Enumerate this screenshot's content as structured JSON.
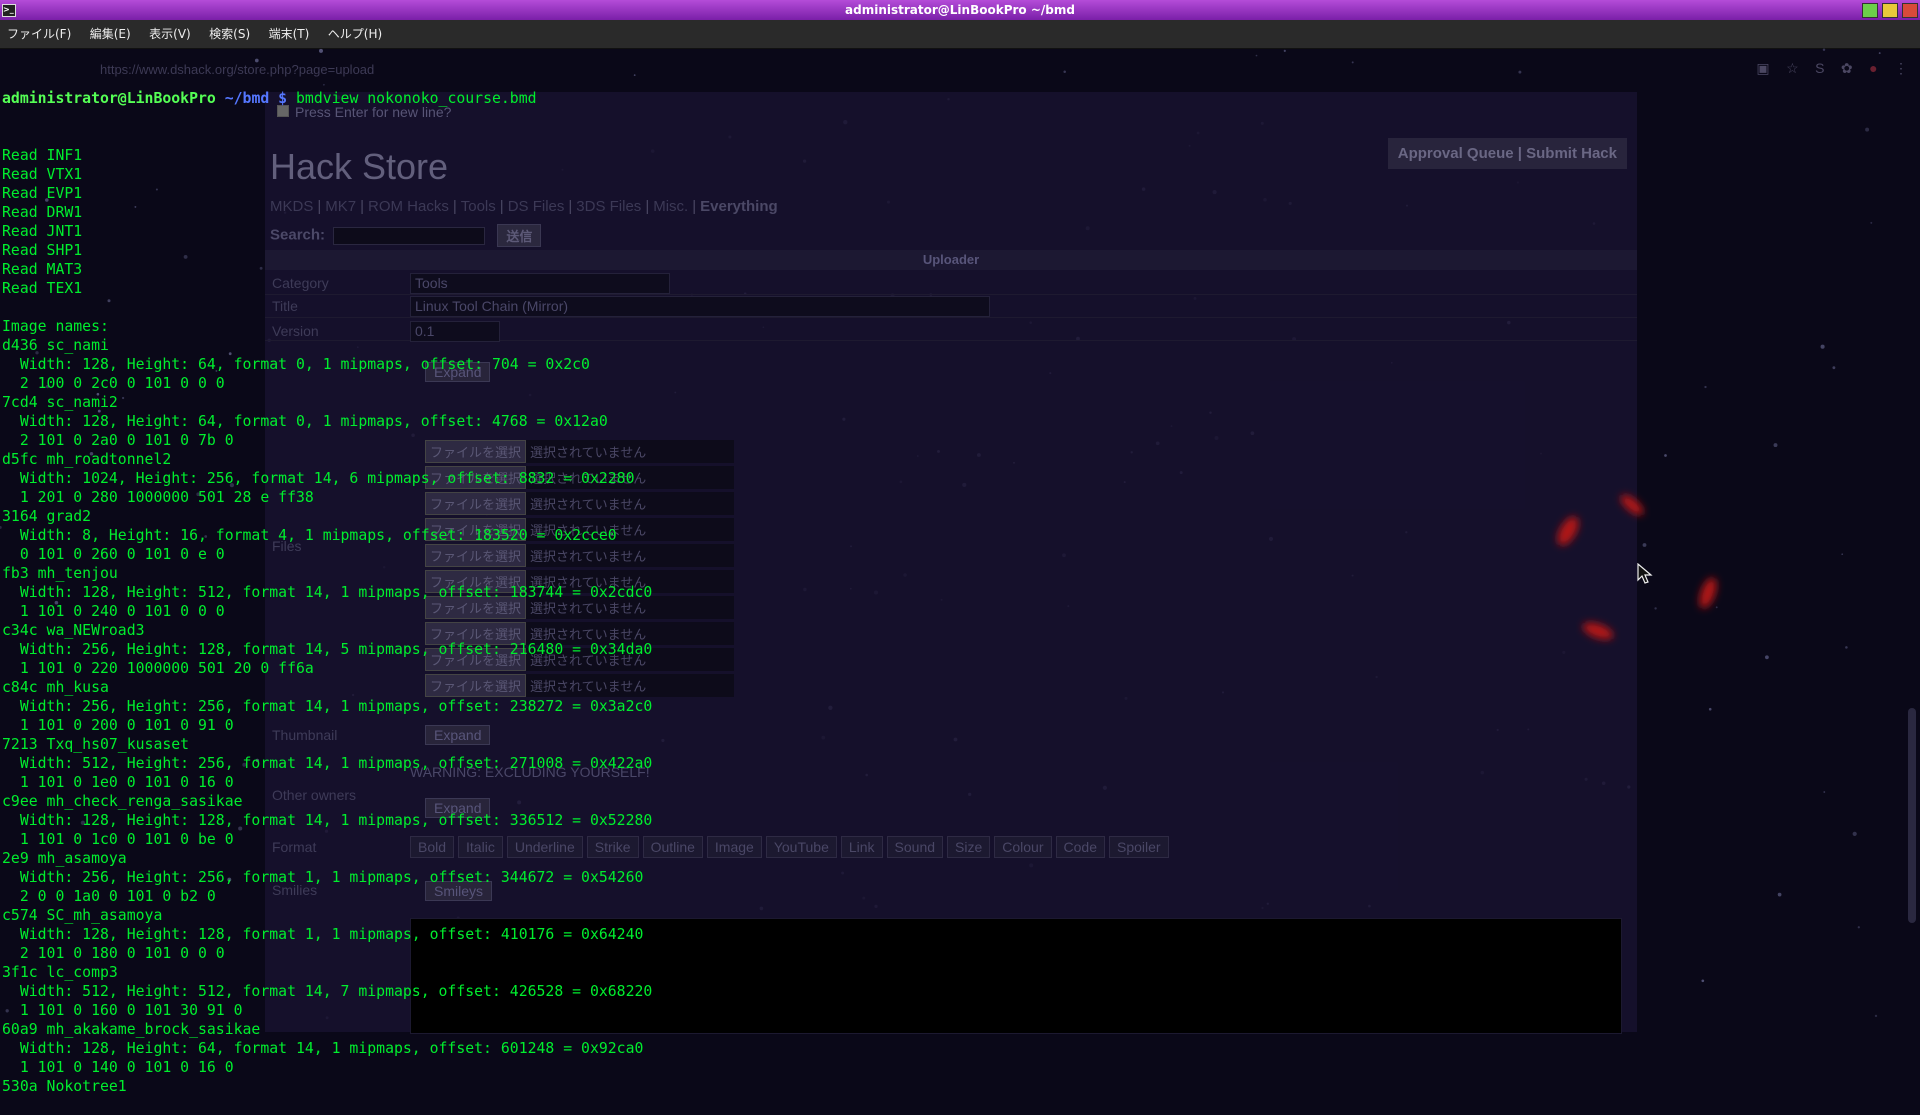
{
  "window": {
    "title": "administrator@LinBookPro ~/bmd",
    "menu": [
      "ファイル(F)",
      "編集(E)",
      "表示(V)",
      "検索(S)",
      "端末(T)",
      "ヘルプ(H)"
    ]
  },
  "browser": {
    "url": "https://www.dshack.org/store.php?page=upload",
    "press_enter_label": "Press Enter for new line?",
    "store_title": "Hack Store",
    "top_links": "Approval Queue | Submit Hack",
    "categories": [
      "MKDS",
      "MK7",
      "ROM Hacks",
      "Tools",
      "DS Files",
      "3DS Files",
      "Misc.",
      "Everything"
    ],
    "search_label": "Search:",
    "search_button": "送信",
    "uploader_heading": "Uploader",
    "form": {
      "category_label": "Category",
      "category_value": "Tools",
      "title_label": "Title",
      "title_value": "Linux Tool Chain (Mirror)",
      "version_label": "Version",
      "version_value": "0.1",
      "expand_label": "Expand",
      "files_label": "Files",
      "file_button": "ファイルを選択",
      "file_status": "選択されていません",
      "thumbnail_label": "Thumbnail",
      "warning": "WARNING: EXCLUDING YOURSELF!",
      "other_owners_label": "Other owners",
      "bbcode_label": "Format",
      "bbcode_buttons": [
        "Bold",
        "Italic",
        "Underline",
        "Strike",
        "Outline",
        "Image",
        "YouTube",
        "Link",
        "Sound",
        "Size",
        "Colour",
        "Code",
        "Spoiler"
      ],
      "smilies_label": "Smilies",
      "smileys_button": "Smileys"
    }
  },
  "terminal": {
    "prompt_user": "administrator@LinBookPro",
    "prompt_dir": " ~/bmd $",
    "command": " bmdview nokonoko_course.bmd",
    "lines": [
      "Read INF1",
      "Read VTX1",
      "Read EVP1",
      "Read DRW1",
      "Read JNT1",
      "Read SHP1",
      "Read MAT3",
      "Read TEX1",
      "",
      "Image names:",
      "d436 sc_nami",
      "  Width: 128, Height: 64, format 0, 1 mipmaps, offset: 704 = 0x2c0",
      "  2 100 0 2c0 0 101 0 0 0",
      "7cd4 sc_nami2",
      "  Width: 128, Height: 64, format 0, 1 mipmaps, offset: 4768 = 0x12a0",
      "  2 101 0 2a0 0 101 0 7b 0",
      "d5fc mh_roadtonnel2",
      "  Width: 1024, Height: 256, format 14, 6 mipmaps, offset: 8832 = 0x2280",
      "  1 201 0 280 1000000 501 28 e ff38",
      "3164 grad2",
      "  Width: 8, Height: 16, format 4, 1 mipmaps, offset: 183520 = 0x2cce0",
      "  0 101 0 260 0 101 0 e 0",
      "fb3 mh_tenjou",
      "  Width: 128, Height: 512, format 14, 1 mipmaps, offset: 183744 = 0x2cdc0",
      "  1 101 0 240 0 101 0 0 0",
      "c34c wa_NEWroad3",
      "  Width: 256, Height: 128, format 14, 5 mipmaps, offset: 216480 = 0x34da0",
      "  1 101 0 220 1000000 501 20 0 ff6a",
      "c84c mh_kusa",
      "  Width: 256, Height: 256, format 14, 1 mipmaps, offset: 238272 = 0x3a2c0",
      "  1 101 0 200 0 101 0 91 0",
      "7213 Txq_hs07_kusaset",
      "  Width: 512, Height: 256, format 14, 1 mipmaps, offset: 271008 = 0x422a0",
      "  1 101 0 1e0 0 101 0 16 0",
      "c9ee mh_check_renga_sasikae",
      "  Width: 128, Height: 128, format 14, 1 mipmaps, offset: 336512 = 0x52280",
      "  1 101 0 1c0 0 101 0 be 0",
      "2e9 mh_asamoya",
      "  Width: 256, Height: 256, format 1, 1 mipmaps, offset: 344672 = 0x54260",
      "  2 0 0 1a0 0 101 0 b2 0",
      "c574 SC_mh_asamoya",
      "  Width: 128, Height: 128, format 1, 1 mipmaps, offset: 410176 = 0x64240",
      "  2 101 0 180 0 101 0 0 0",
      "3f1c lc_comp3",
      "  Width: 512, Height: 512, format 14, 7 mipmaps, offset: 426528 = 0x68220",
      "  1 101 0 160 0 101 30 91 0",
      "60a9 mh_akakame_brock_sasikae",
      "  Width: 128, Height: 64, format 14, 1 mipmaps, offset: 601248 = 0x92ca0",
      "  1 101 0 140 0 101 0 16 0",
      "530a Nokotree1"
    ]
  },
  "colors": {
    "titlebar": "#9a38c4",
    "terminal_text": "#00ee2e",
    "prompt_user": "#55ff55",
    "prompt_dir": "#5577ff"
  }
}
